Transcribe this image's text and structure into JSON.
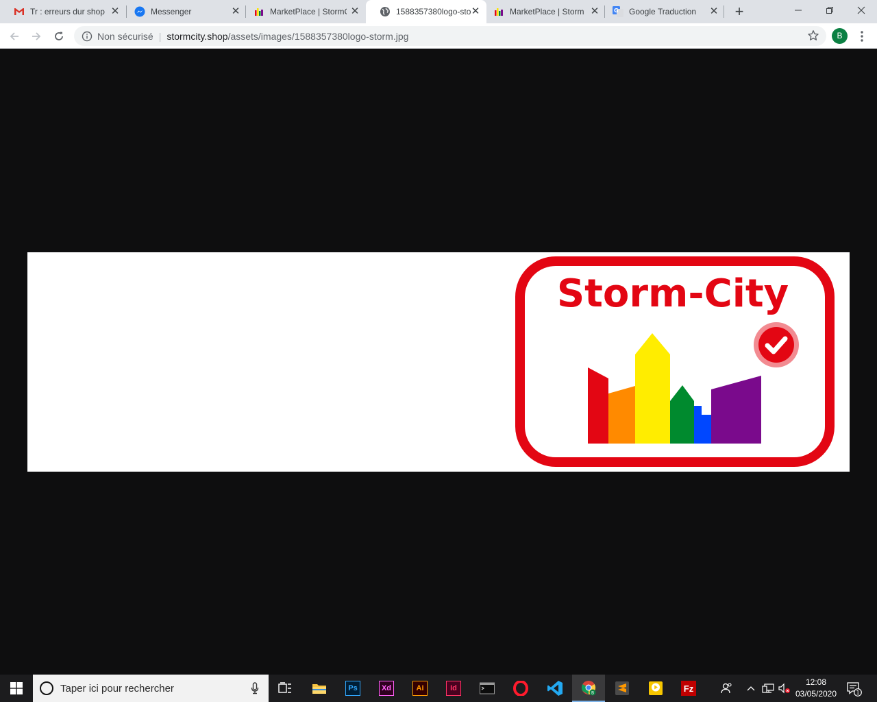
{
  "tabs": [
    {
      "title": "Tr : erreurs dur shop",
      "icon": "gmail-icon"
    },
    {
      "title": "Messenger",
      "icon": "messenger-icon"
    },
    {
      "title": "MarketPlace | StormC",
      "icon": "stormcity-favicon-icon"
    },
    {
      "title": "1588357380logo-sto",
      "icon": "globe-icon",
      "active": true
    },
    {
      "title": "MarketPlace | StormC",
      "icon": "stormcity-favicon-icon"
    },
    {
      "title": "Google Traduction",
      "icon": "google-translate-icon"
    }
  ],
  "address": {
    "security": "Non sécurisé",
    "host": "stormcity.shop",
    "path": "/assets/images/1588357380logo-storm.jpg"
  },
  "profile": {
    "initial": "B"
  },
  "logo": {
    "text": "Storm-City",
    "color": "#e30613"
  },
  "taskbar": {
    "search_placeholder": "Taper ici pour rechercher",
    "apps": [
      "task-view",
      "file-explorer",
      "photoshop",
      "adobe-xd",
      "illustrator",
      "indesign",
      "terminal",
      "opera",
      "vscode",
      "chrome",
      "sublime-text",
      "media-player",
      "filezilla"
    ],
    "labels": {
      "ps": "Ps",
      "xd": "Xd",
      "ai": "Ai",
      "id": "Id",
      "fz": "Fz"
    },
    "time": "12:08",
    "date": "03/05/2020",
    "notification_count": "1"
  }
}
